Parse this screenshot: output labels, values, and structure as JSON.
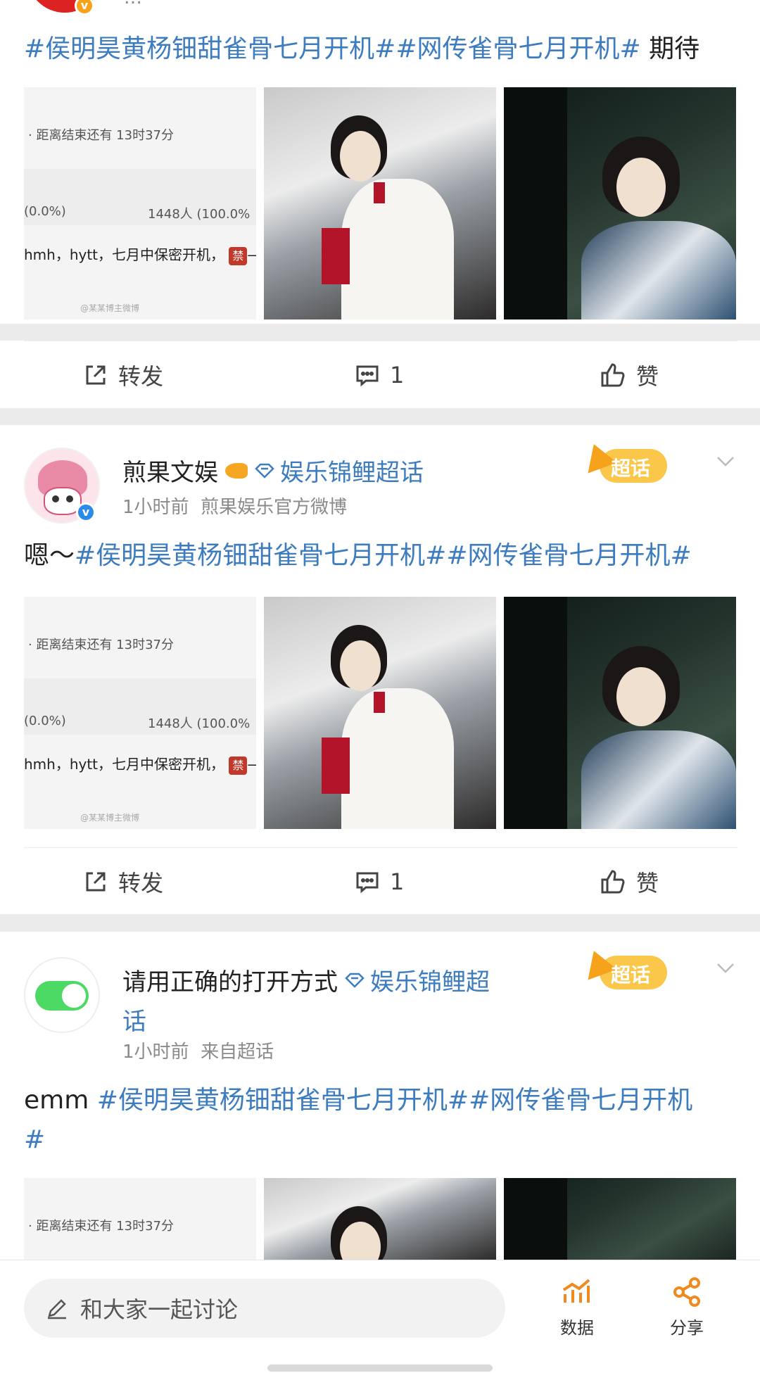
{
  "post1": {
    "author_cut": "…",
    "meta_cut": "…",
    "text_hashtags": "#侯明昊黄杨钿甜雀骨七月开机##网传雀骨七月开机#",
    "text_suffix": " 期待",
    "comments_count": "1"
  },
  "post2": {
    "author": "煎果文娱",
    "topic": "娱乐锦鲤超话",
    "time": "1小时前",
    "source": "煎果娱乐官方微博",
    "text_prefix": "嗯～",
    "text_hashtags": "#侯明昊黄杨钿甜雀骨七月开机##网传雀骨七月开机#",
    "comments_count": "1",
    "badge_label": "超话"
  },
  "post3": {
    "author": "请用正确的打开方式",
    "topic_line1": "娱乐锦鲤超",
    "topic_line2": "话",
    "time": "1小时前",
    "source": "来自超话",
    "text_prefix": "emm ",
    "text_hashtags_line1": "#侯明昊黄杨钿甜雀骨七月开机##网传雀骨七月开机",
    "text_hashtags_line2": "#",
    "badge_label": "超话"
  },
  "poll_tile": {
    "countdown": "· 距离结束还有 13时37分",
    "left_pct": "(0.0%)",
    "right_count": "1448人 (100.0%",
    "option_text": "hmh，hytt，七月中保密开机，",
    "banned_char": "禁",
    "watermark": "@某某博主微博"
  },
  "actions": {
    "repost_label": "转发",
    "like_label": "赞"
  },
  "bottombar": {
    "input_placeholder": "和大家一起讨论",
    "data_label": "数据",
    "share_label": "分享"
  },
  "colors": {
    "link": "#3d7cbf",
    "accent_orange": "#f08a1c",
    "toggle_green": "#4cd964"
  }
}
